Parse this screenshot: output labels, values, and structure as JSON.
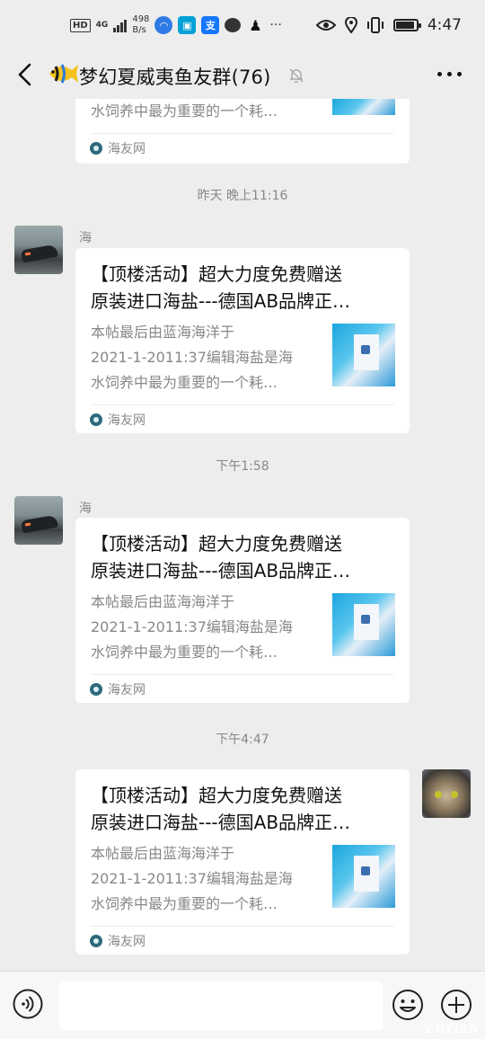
{
  "status_bar": {
    "network_badge": "HD",
    "network_type": "4G",
    "speed_value": "498",
    "speed_unit": "B/s",
    "time": "4:47",
    "battery_level": 0.9,
    "notification_icons": [
      "baidu-netdisk-icon",
      "bilibili-icon",
      "alipay-icon",
      "chat-bubble-icon",
      "qq-icon",
      "more-dots-icon"
    ]
  },
  "header": {
    "title": "梦幻夏威夷鱼友群(76)",
    "muted": true
  },
  "messages": [
    {
      "partial": true,
      "desc_line3": "水饲养中最为重要的一个耗…",
      "source": "海友网"
    },
    {
      "timestamp": "昨天 晚上11:16",
      "sender": "海",
      "title_line1": "【顶楼活动】超大力度免费赠送",
      "title_line2": "原装进口海盐---德国AB品牌正…",
      "desc_line1": "本帖最后由蓝海海洋于",
      "desc_line2": "2021-1-2011:37编辑海盐是海",
      "desc_line3": "水饲养中最为重要的一个耗…",
      "source": "海友网"
    },
    {
      "timestamp": "下午1:58",
      "sender": "海",
      "title_line1": "【顶楼活动】超大力度免费赠送",
      "title_line2": "原装进口海盐---德国AB品牌正…",
      "desc_line1": "本帖最后由蓝海海洋于",
      "desc_line2": "2021-1-2011:37编辑海盐是海",
      "desc_line3": "水饲养中最为重要的一个耗…",
      "source": "海友网"
    },
    {
      "timestamp": "下午4:47",
      "own": true,
      "title_line1": "【顶楼活动】超大力度免费赠送",
      "title_line2": "原装进口海盐---德国AB品牌正…",
      "desc_line1": "本帖最后由蓝海海洋于",
      "desc_line2": "2021-1-2011:37编辑海盐是海",
      "desc_line3": "水饲养中最为重要的一个耗…",
      "source": "海友网"
    }
  ],
  "input": {
    "value": "",
    "placeholder": ""
  },
  "watermark": "cnfish"
}
